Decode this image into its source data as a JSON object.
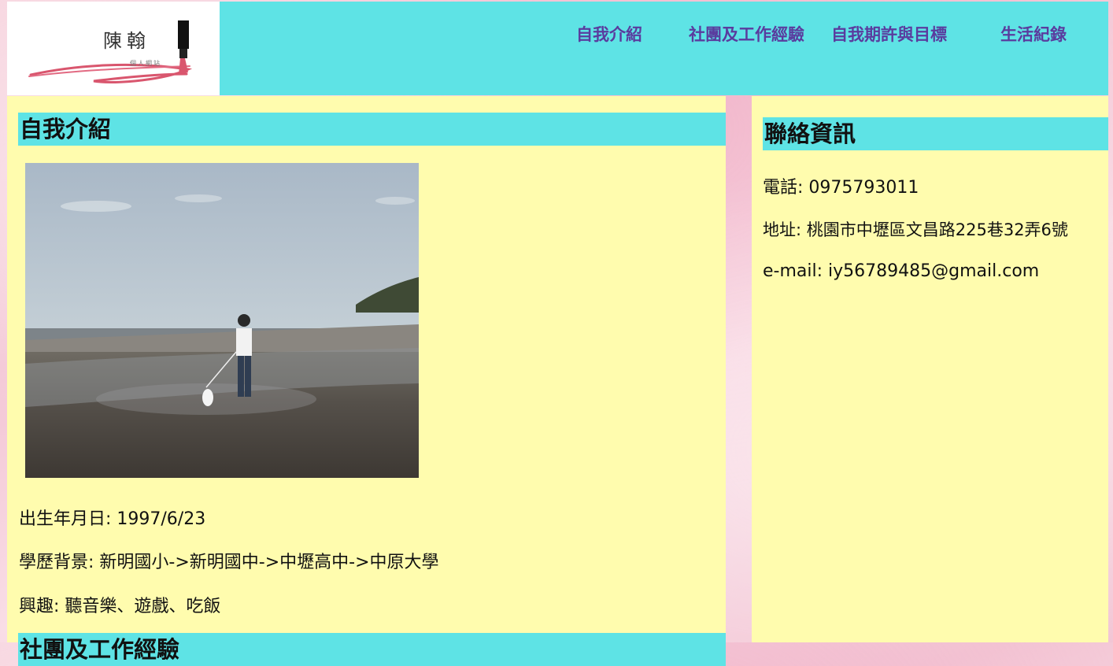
{
  "logo": {
    "name": "陳翰",
    "subtitle": "個人網站"
  },
  "nav": {
    "items": [
      {
        "label": "自我介紹"
      },
      {
        "label": "社團及工作經驗"
      },
      {
        "label": "自我期許與目標"
      },
      {
        "label": "生活紀錄"
      }
    ]
  },
  "intro": {
    "heading": "自我介紹",
    "birthday": "出生年月日: 1997/6/23",
    "education": "學歷背景: 新明國小->新明國中->中壢高中->中原大學",
    "hobbies": "興趣: 聽音樂、遊戲、吃飯"
  },
  "next_section": {
    "heading": "社團及工作經驗"
  },
  "contact": {
    "heading": "聯絡資訊",
    "phone": "電話: 0975793011",
    "address": "地址: 桃園市中壢區文昌路225巷32弄6號",
    "email": "e-mail: iy56789485@gmail.com"
  },
  "colors": {
    "accent": "#5ee3e5",
    "content_bg": "#fffcae",
    "nav_text": "#5a3c9e",
    "page_bg": "#f3c5d4"
  }
}
